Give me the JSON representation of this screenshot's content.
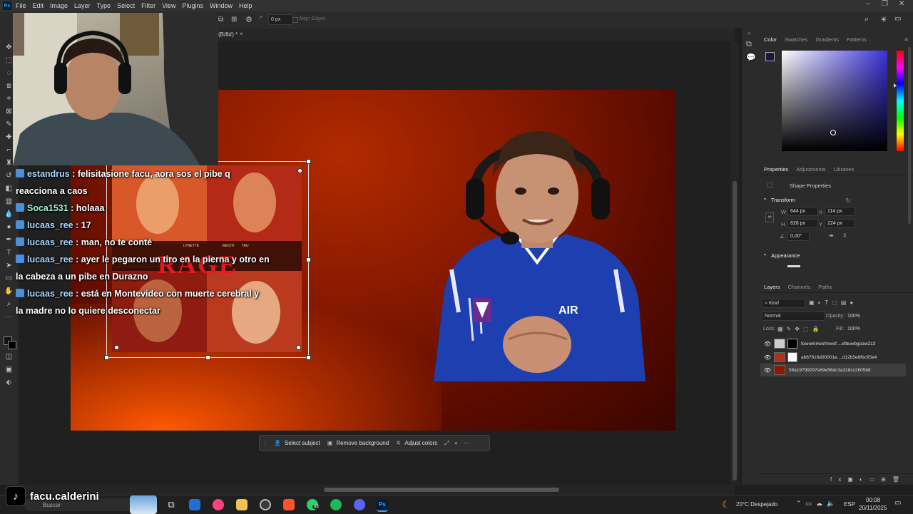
{
  "menubar": {
    "items": [
      "File",
      "Edit",
      "Image",
      "Layer",
      "Type",
      "Select",
      "Filter",
      "View",
      "Plugins",
      "Window",
      "Help"
    ]
  },
  "options_bar": {
    "radius": "0 px",
    "align_edges": "Align Edges"
  },
  "doc_tab": {
    "title": "(B/8#) *",
    "close": "×"
  },
  "chat": {
    "lines": [
      {
        "user": "estandrus",
        "text": " : felisitasione facu, aora sos el pibe q",
        "icon": true
      },
      {
        "user": "",
        "text": "reacciona a caos",
        "icon": false
      },
      {
        "user": "Soca1531",
        "text": " : holaaa",
        "icon": true
      },
      {
        "user": "lucaas_ree",
        "text": " : 17",
        "icon": true
      },
      {
        "user": "lucaas_ree",
        "text": " : man, no te conté",
        "icon": true
      },
      {
        "user": "lucaas_ree",
        "text": " : ayer le pegaron un tiro en la pierna y otro en",
        "icon": true
      },
      {
        "user": "",
        "text": "la cabeza a un pibe en Durazno",
        "icon": false
      },
      {
        "user": "lucaas_ree",
        "text": " : está en Montevideo con muerte cerebral y",
        "icon": true
      },
      {
        "user": "",
        "text": "la madre no lo quiere desconectar",
        "icon": false
      }
    ]
  },
  "poster": {
    "title": "RAGE",
    "names": [
      "LYNETTE",
      "MECHI",
      "TAU"
    ]
  },
  "context_bar": {
    "select_subject": "Select subject",
    "remove_background": "Remove background",
    "adjust_colors": "Adjust colors",
    "more": "···"
  },
  "color_panel": {
    "tabs": [
      "Color",
      "Swatches",
      "Gradients",
      "Patterns"
    ]
  },
  "properties_panel": {
    "tabs": [
      "Properties",
      "Adjustments",
      "Libraries"
    ],
    "shape_properties": "Shape Properties",
    "transform": "Transform",
    "w": "644 px",
    "x": "114 px",
    "h": "628 px",
    "y": "224 px",
    "angle": "0,00°",
    "w_label": "W",
    "h_label": "H",
    "x_label": "X",
    "y_label": "Y",
    "appearance": "Appearance"
  },
  "layers_panel": {
    "tabs": [
      "Layers",
      "Channels",
      "Paths"
    ],
    "kind": "Kind",
    "blend_mode": "Normal",
    "opacity_label": "Opacity:",
    "opacity": "100%",
    "lock_label": "Lock:",
    "fill_label": "Fill:",
    "fill": "100%",
    "layers": [
      {
        "name": "foiewmnwofmwof....efbuwbgoaw213",
        "selected": false
      },
      {
        "name": "ab67616d00001e....d12b5e6fbc65e4",
        "selected": false
      },
      {
        "name": "59a19799297e69e56dc3a318cc2605b8",
        "selected": true
      }
    ]
  },
  "taskbar": {
    "search": "Buscar",
    "weather": "20°C Despejado",
    "language": "ESP",
    "time": "00:08",
    "date": "20/11/2025",
    "whatsapp_badge": "88"
  },
  "overlay": {
    "tiktok_handle": "facu.calderini"
  },
  "colors": {
    "accent_blue": "#31a8ff",
    "chat_user": "#a8d8ff",
    "artboard_red": "#8a1a00"
  }
}
